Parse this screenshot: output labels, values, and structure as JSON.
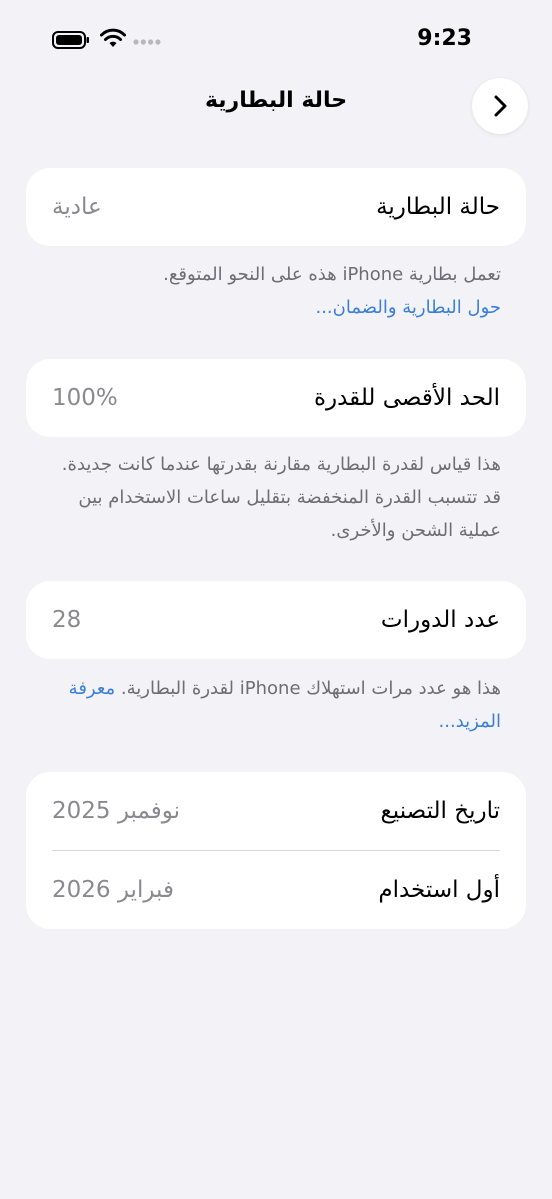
{
  "status_bar": {
    "time": "9:23",
    "icons": [
      "battery-icon",
      "wifi-icon",
      "cellular-signal-icon"
    ]
  },
  "nav": {
    "title": "حالة البطارية",
    "back_icon": "chevron-right-icon"
  },
  "battery_health": {
    "label": "حالة البطارية",
    "value": "عادية",
    "footnote_text": "تعمل بطارية iPhone هذه على النحو المتوقع.",
    "footnote_link": "حول البطارية والضمان..."
  },
  "max_capacity": {
    "label": "الحد الأقصى للقدرة",
    "value": "100%",
    "footnote_text": "هذا قياس لقدرة البطارية مقارنة بقدرتها عندما كانت جديدة. قد تتسبب القدرة المنخفضة بتقليل ساعات الاستخدام بين عملية الشحن والأخرى."
  },
  "cycle_count": {
    "label": "عدد الدورات",
    "value": "28",
    "footnote_text": "هذا هو عدد مرات استهلاك iPhone لقدرة البطارية.",
    "footnote_link": "معرفة المزيد..."
  },
  "dates": {
    "manufacture_label": "تاريخ التصنيع",
    "manufacture_value": "نوفمبر 2025",
    "first_use_label": "أول استخدام",
    "first_use_value": "فبراير 2026"
  },
  "colors": {
    "background": "#f2f2f7",
    "card": "#ffffff",
    "secondary_text": "#8a8a8e",
    "footnote_text": "#6d6d72",
    "link": "#3c7fd8"
  }
}
